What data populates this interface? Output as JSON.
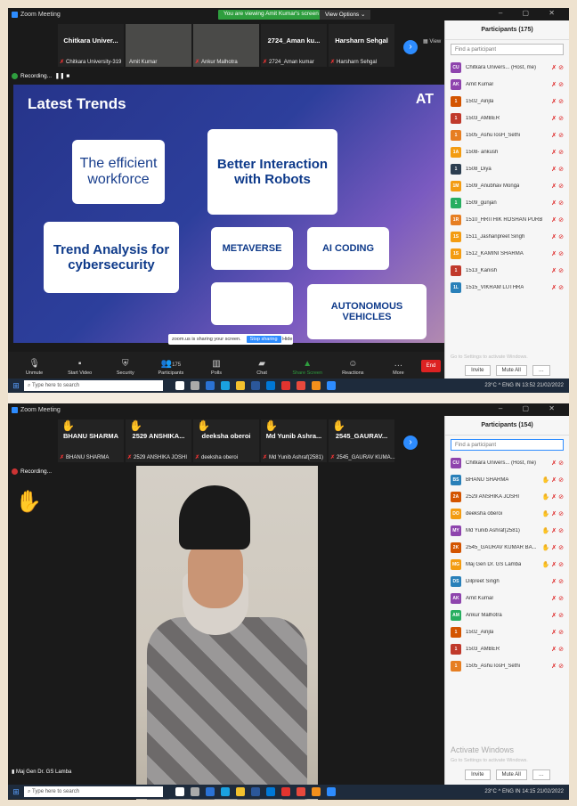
{
  "screen1": {
    "title": "Zoom Meeting",
    "viewing_banner": "You are viewing Amit Kumar's screen",
    "view_options": "View Options ⌄",
    "view_label": "View",
    "tiles": [
      {
        "name": "Chitkara Univer...",
        "sub": "Chitkara University-319"
      },
      {
        "name": "",
        "sub": "Amit Kumar"
      },
      {
        "name": "",
        "sub": "Ankur Malhotra"
      },
      {
        "name": "2724_Aman ku...",
        "sub": "2724_Aman kumar"
      },
      {
        "name": "Harsharn Sehgal",
        "sub": "Harsharn Sehgal"
      }
    ],
    "recording": "Recording...",
    "slide": {
      "title": "Latest Trends",
      "logo": "AT",
      "cards": [
        "The efficient workforce",
        "Better Interaction with Robots",
        "Trend Analysis for cybersecurity",
        "METAVERSE",
        "AI CODING",
        "AUTONOMOUS VEHICLES"
      ]
    },
    "share_bar": {
      "text": "zoom.us is sharing your screen.",
      "stop": "Stop sharing",
      "hide": "Hide"
    },
    "toolbar": [
      "Unmute",
      "Start Video",
      "Security",
      "Participants",
      "Polls",
      "Chat",
      "Share Screen",
      "Reactions",
      "More"
    ],
    "participants_count": "175",
    "end_label": "End",
    "panel_title": "Participants (175)",
    "find_placeholder": "Find a participant",
    "participants": [
      {
        "initials": "CU",
        "name": "Chitkara Univers... (Host, me)",
        "color": "#8e44ad"
      },
      {
        "initials": "AK",
        "name": "Amit Kumar",
        "color": "#8e44ad"
      },
      {
        "initials": "1",
        "name": "1502_Ainjla",
        "color": "#d35400"
      },
      {
        "initials": "1",
        "name": "1503_AMBER",
        "color": "#c0392b"
      },
      {
        "initials": "1",
        "name": "1505_AshuTosH_Sethi",
        "color": "#e67e22"
      },
      {
        "initials": "1A",
        "name": "1508- ankush",
        "color": "#f39c12"
      },
      {
        "initials": "1",
        "name": "1508_Diya",
        "color": "#2c3e50"
      },
      {
        "initials": "1M",
        "name": "1509_Anubhav Monga",
        "color": "#f39c12"
      },
      {
        "initials": "1",
        "name": "1509_gunjan",
        "color": "#27ae60"
      },
      {
        "initials": "1R",
        "name": "1510_HRITHIK ROSHAN PURBA",
        "color": "#e67e22"
      },
      {
        "initials": "1S",
        "name": "1511_Jashanpreet Singh",
        "color": "#f39c12"
      },
      {
        "initials": "1S",
        "name": "1512_KAMINI SHARMA",
        "color": "#f39c12"
      },
      {
        "initials": "1",
        "name": "1513_Kanish",
        "color": "#c0392b"
      },
      {
        "initials": "1L",
        "name": "1515_VIKRAM LUTHRA",
        "color": "#2980b9"
      }
    ],
    "activate": "Go to Settings to activate Windows.",
    "invite": "Invite",
    "mute_all": "Mute All",
    "taskbar": {
      "search": "Type here to search",
      "temp": "23°C",
      "lang": "ENG IN",
      "time": "13:52",
      "date": "21/02/2022"
    }
  },
  "screen2": {
    "title": "Zoom Meeting",
    "tiles": [
      {
        "name": "BHANU SHARMA",
        "sub": "BHANU SHARMA"
      },
      {
        "name": "2529 ANSHIKA...",
        "sub": "2529 ANSHIKA JOSHI"
      },
      {
        "name": "deeksha oberoi",
        "sub": "deeksha oberoi"
      },
      {
        "name": "Md Yunib Ashra...",
        "sub": "Md Yunib Ashraf(2581)"
      },
      {
        "name": "2545_GAURAV...",
        "sub": "2545_GAURAV KUMA..."
      }
    ],
    "recording": "Recording...",
    "cam_label": "Maj Gen Dr. GS Lamba",
    "panel_title": "Participants (154)",
    "find_placeholder": "Find a participant",
    "participants": [
      {
        "initials": "CU",
        "name": "Chitkara Univers... (Host, me)",
        "color": "#8e44ad"
      },
      {
        "initials": "BS",
        "name": "BHANU SHARMA",
        "color": "#2980b9"
      },
      {
        "initials": "2A",
        "name": "2529 ANSHIKA JOSHI",
        "color": "#d35400"
      },
      {
        "initials": "DO",
        "name": "deeksha oberoi",
        "color": "#f39c12"
      },
      {
        "initials": "MY",
        "name": "Md Yunib Ashraf(2581)",
        "color": "#8e44ad"
      },
      {
        "initials": "2K",
        "name": "2545_GAURAV KUMAR BA...",
        "color": "#d35400"
      },
      {
        "initials": "MG",
        "name": "Maj Gen Dr. GS Lamba",
        "color": "#f39c12"
      },
      {
        "initials": "DS",
        "name": "Dilpreet Singh",
        "color": "#2980b9"
      },
      {
        "initials": "AK",
        "name": "Amit Kumar",
        "color": "#8e44ad"
      },
      {
        "initials": "AM",
        "name": "Ankur Malhotra",
        "color": "#27ae60"
      },
      {
        "initials": "1",
        "name": "1502_Ainjla",
        "color": "#d35400"
      },
      {
        "initials": "1",
        "name": "1503_AMBER",
        "color": "#c0392b"
      },
      {
        "initials": "1",
        "name": "1505_AshuTosH_Sethi",
        "color": "#e67e22"
      }
    ],
    "activate_title": "Activate Windows",
    "activate": "Go to Settings to activate Windows.",
    "invite": "Invite",
    "mute_all": "Mute All",
    "taskbar": {
      "search": "Type here to search",
      "temp": "23°C",
      "lang": "ENG IN",
      "time": "14:15",
      "date": "21/02/2022"
    }
  }
}
